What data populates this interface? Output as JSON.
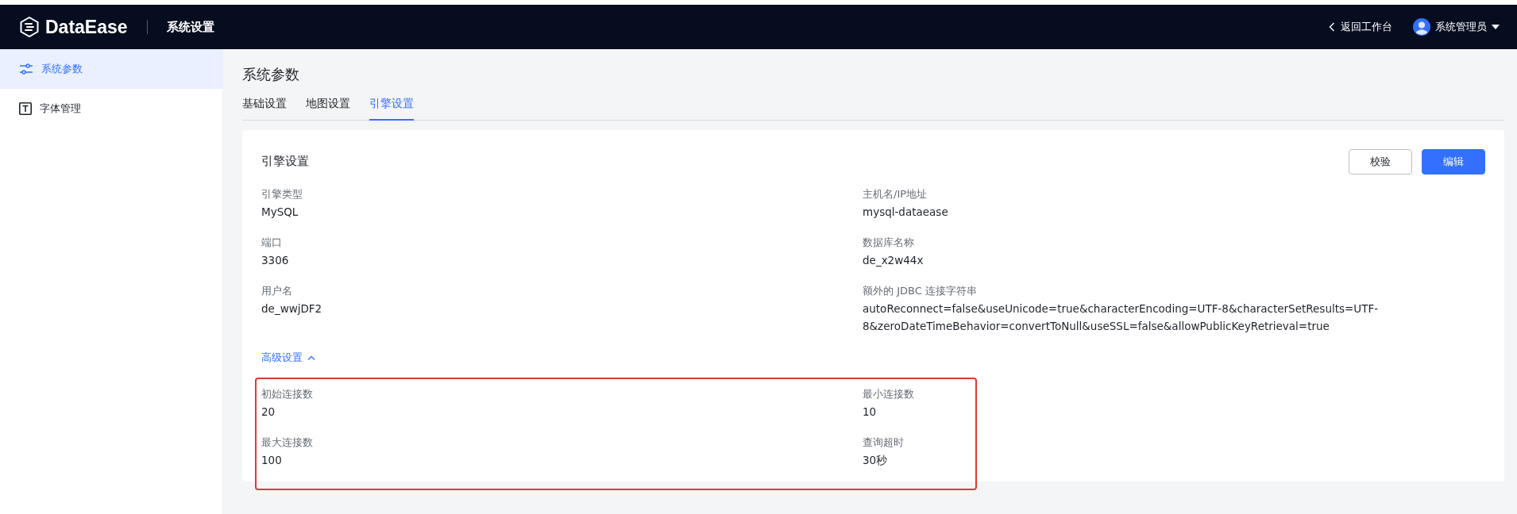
{
  "header": {
    "brand": "DataEase",
    "section": "系统设置",
    "back_link": "返回工作台",
    "user": "系统管理员"
  },
  "sidebar": {
    "items": [
      {
        "label": "系统参数",
        "selected": true
      },
      {
        "label": "字体管理",
        "selected": false
      }
    ]
  },
  "page_title": "系统参数",
  "tabs": [
    {
      "label": "基础设置",
      "selected": false
    },
    {
      "label": "地图设置",
      "selected": false
    },
    {
      "label": "引擎设置",
      "selected": true
    }
  ],
  "card": {
    "title": "引擎设置",
    "buttons": [
      {
        "label": "校验",
        "kind": "secondary"
      },
      {
        "label": "编辑",
        "kind": "primary"
      }
    ],
    "fields": [
      {
        "label": "引擎类型",
        "value": "MySQL"
      },
      {
        "label": "主机名/IP地址",
        "value": "mysql-dataease"
      },
      {
        "label": "端口",
        "value": "3306"
      },
      {
        "label": "数据库名称",
        "value": "de_x2w44x"
      },
      {
        "label": "用户名",
        "value": "de_wwjDF2"
      },
      {
        "label": "额外的 JDBC 连接字符串",
        "value": "autoReconnect=false&useUnicode=true&characterEncoding=UTF-8&characterSetResults=UTF-8&zeroDateTimeBehavior=convertToNull&useSSL=false&allowPublicKeyRetrieval=true"
      }
    ],
    "advanced": {
      "label": "高级设置",
      "expanded": true,
      "highlighted": true,
      "fields": [
        {
          "label": "初始连接数",
          "value": "20"
        },
        {
          "label": "最小连接数",
          "value": "10"
        },
        {
          "label": "最大连接数",
          "value": "100"
        },
        {
          "label": "查询超时",
          "value": "30秒"
        }
      ]
    }
  }
}
